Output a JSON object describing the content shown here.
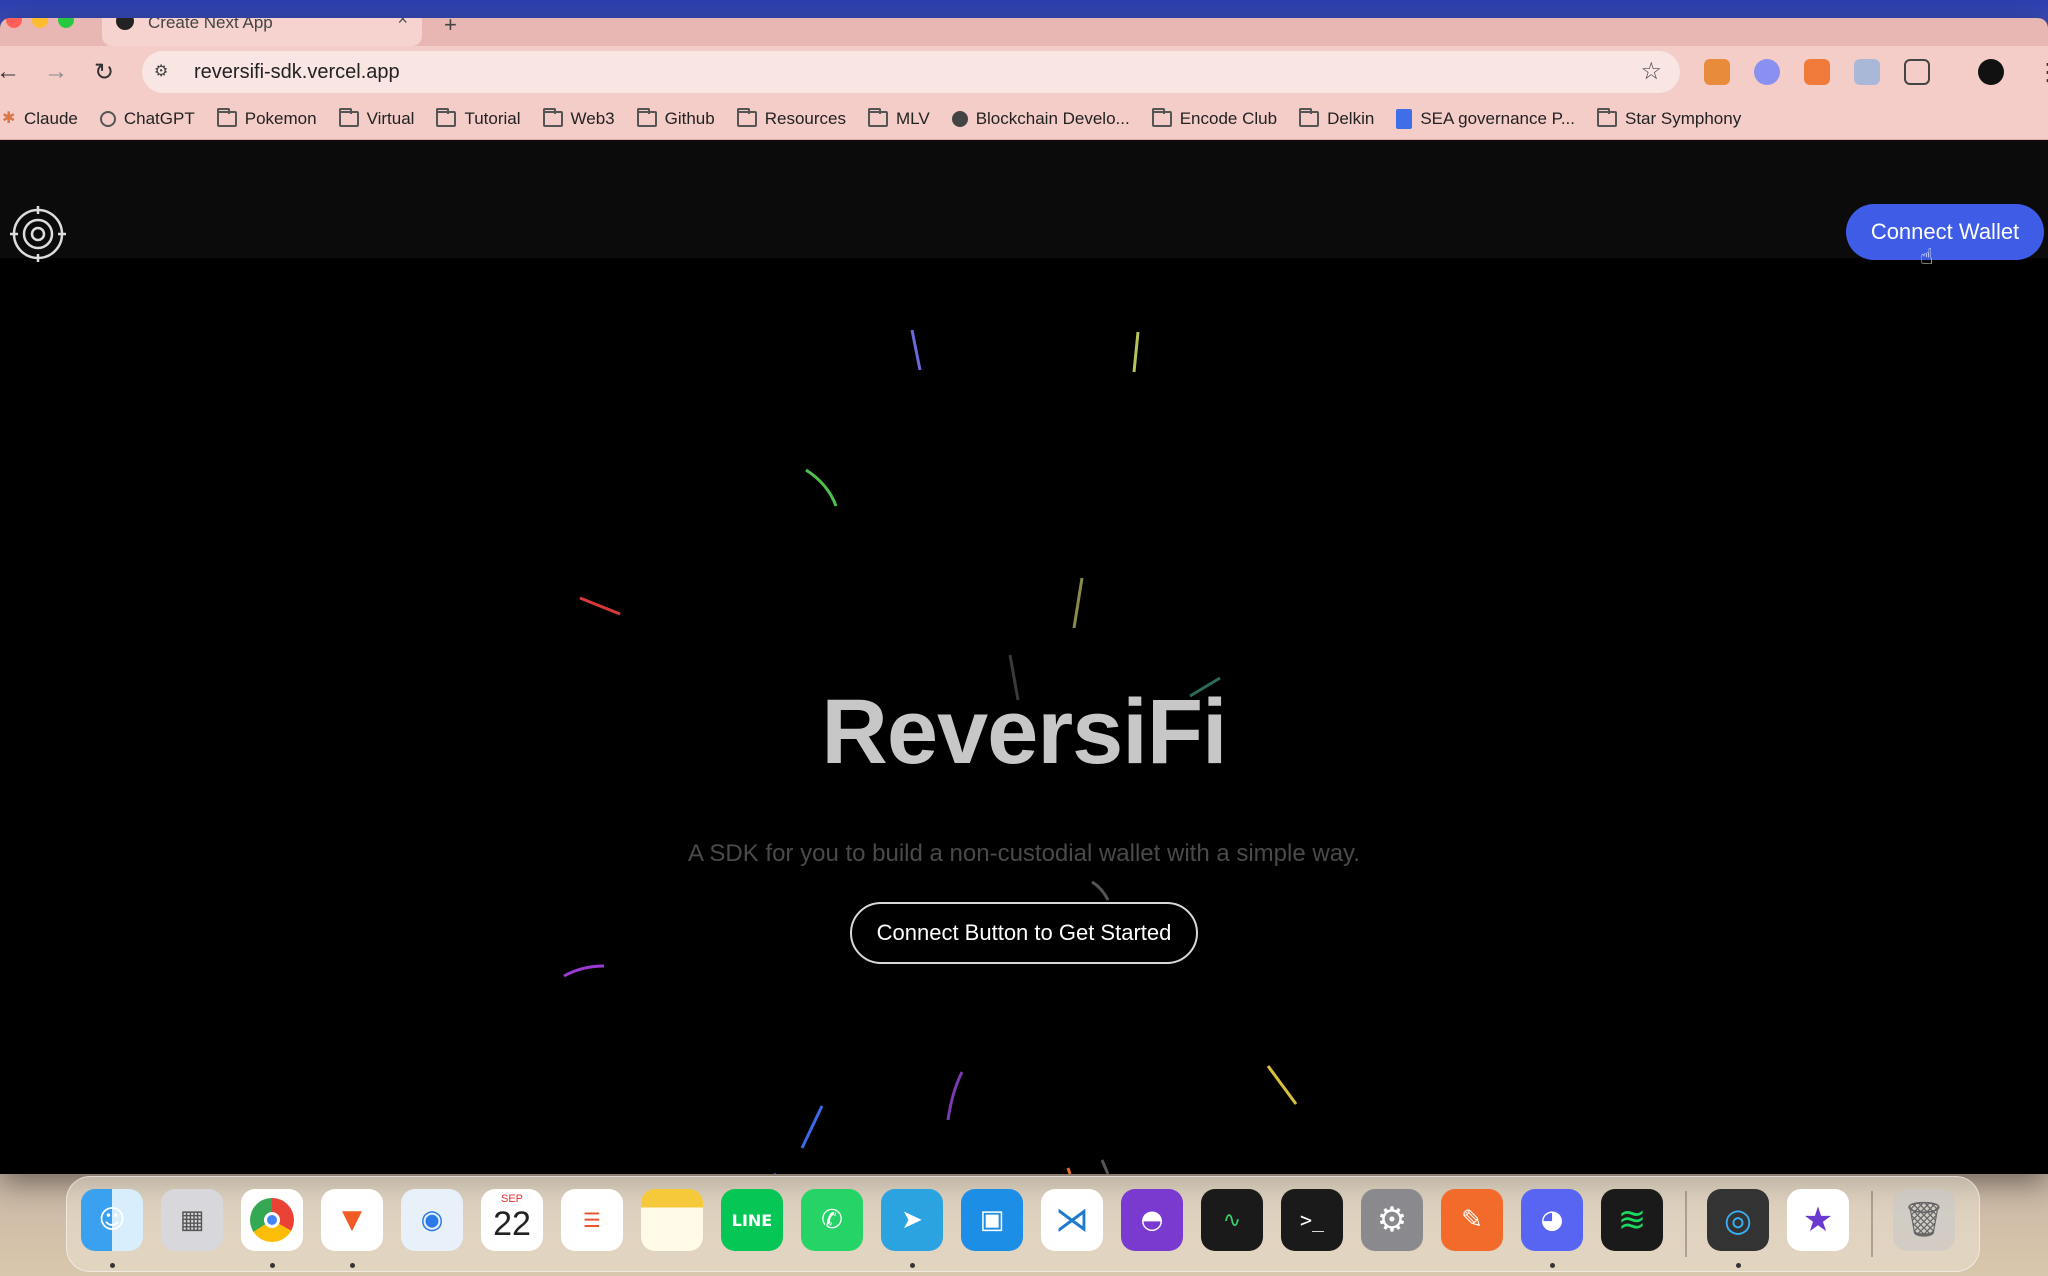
{
  "browser": {
    "tab_title": "Create Next App",
    "url": "reversifi-sdk.vercel.app",
    "bookmarks": [
      {
        "label": "Claude",
        "icon": "claude-icon"
      },
      {
        "label": "ChatGPT",
        "icon": "chatgpt-icon"
      },
      {
        "label": "Pokemon",
        "icon": "folder-icon"
      },
      {
        "label": "Virtual",
        "icon": "folder-icon"
      },
      {
        "label": "Tutorial",
        "icon": "folder-icon"
      },
      {
        "label": "Web3",
        "icon": "folder-icon"
      },
      {
        "label": "Github",
        "icon": "folder-icon"
      },
      {
        "label": "Resources",
        "icon": "folder-icon"
      },
      {
        "label": "MLV",
        "icon": "folder-icon"
      },
      {
        "label": "Blockchain Develo...",
        "icon": "globe-icon"
      },
      {
        "label": "Encode Club",
        "icon": "folder-icon"
      },
      {
        "label": "Delkin",
        "icon": "folder-icon"
      },
      {
        "label": "SEA governance P...",
        "icon": "docs-icon"
      },
      {
        "label": "Star Symphony",
        "icon": "folder-icon"
      }
    ]
  },
  "header": {
    "connect_wallet_label": "Connect Wallet"
  },
  "hero": {
    "title": "ReversiFi",
    "subtitle": "A SDK for you to build a non-custodial wallet with a simple way.",
    "cta_label": "Connect Button to Get Started"
  },
  "dock": {
    "calendar_month": "SEP",
    "calendar_day": "22",
    "apps": [
      "finder-icon",
      "launchpad-icon",
      "chrome-icon",
      "brave-icon",
      "safari-icon",
      "calendar-icon",
      "reminders-icon",
      "notes-icon",
      "line-icon",
      "whatsapp-icon",
      "telegram-icon",
      "docker-icon",
      "vscode-icon",
      "github-desktop-icon",
      "activity-monitor-icon",
      "terminal-icon",
      "system-settings-icon",
      "postman-icon",
      "discord-icon",
      "spotify-icon",
      "quicktime-icon",
      "imovie-icon",
      "trash-icon"
    ]
  },
  "colors": {
    "accent": "#3e5ce6",
    "page_bg": "#000000",
    "browser_chrome": "#f4ccc8"
  }
}
